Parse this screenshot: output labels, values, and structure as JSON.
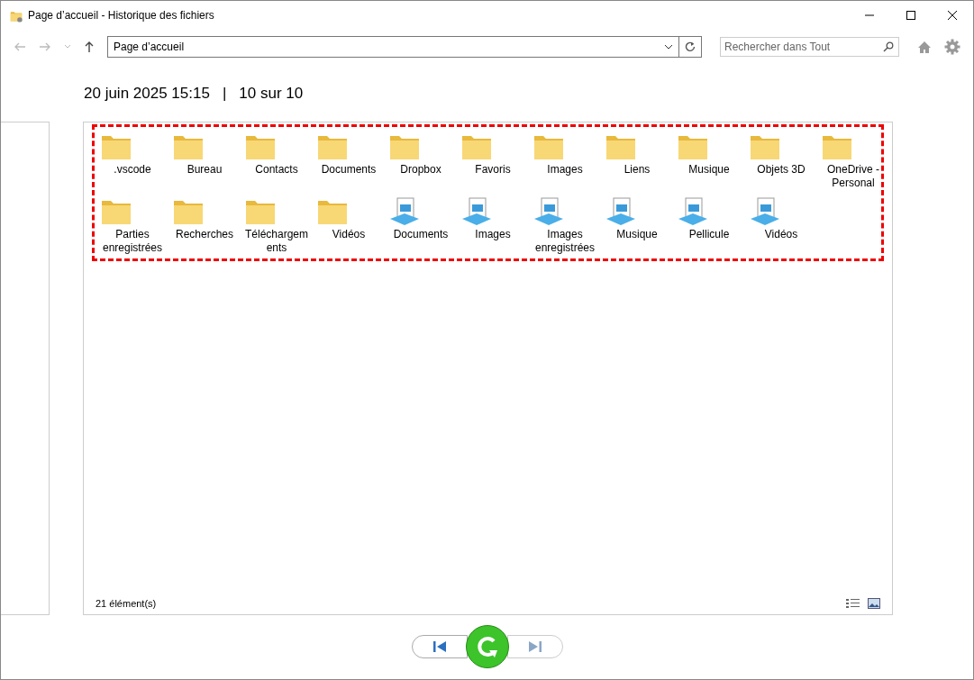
{
  "window": {
    "title": "Page d’accueil - Historique des fichiers"
  },
  "address": {
    "value": "Page d’accueil"
  },
  "search": {
    "placeholder": "Rechercher dans Tout"
  },
  "snapshot": {
    "date": "20 juin 2025 15:15",
    "separator": "|",
    "position": "10 sur 10"
  },
  "items": [
    {
      "label": ".vscode",
      "kind": "folder"
    },
    {
      "label": "Bureau",
      "kind": "folder"
    },
    {
      "label": "Contacts",
      "kind": "folder"
    },
    {
      "label": "Documents",
      "kind": "folder"
    },
    {
      "label": "Dropbox",
      "kind": "folder"
    },
    {
      "label": "Favoris",
      "kind": "folder"
    },
    {
      "label": "Images",
      "kind": "folder"
    },
    {
      "label": "Liens",
      "kind": "folder"
    },
    {
      "label": "Musique",
      "kind": "folder"
    },
    {
      "label": "Objets 3D",
      "kind": "folder"
    },
    {
      "label": "OneDrive - Personal",
      "kind": "folder"
    },
    {
      "label": "Parties enregistrées",
      "kind": "folder"
    },
    {
      "label": "Recherches",
      "kind": "folder"
    },
    {
      "label": "Téléchargements",
      "kind": "folder"
    },
    {
      "label": "Vidéos",
      "kind": "folder"
    },
    {
      "label": "Documents",
      "kind": "library"
    },
    {
      "label": "Images",
      "kind": "library"
    },
    {
      "label": "Images enregistrées",
      "kind": "library"
    },
    {
      "label": "Musique",
      "kind": "library"
    },
    {
      "label": "Pellicule",
      "kind": "library"
    },
    {
      "label": "Vidéos",
      "kind": "library"
    }
  ],
  "status_bar": {
    "count": "21 élément(s)"
  }
}
